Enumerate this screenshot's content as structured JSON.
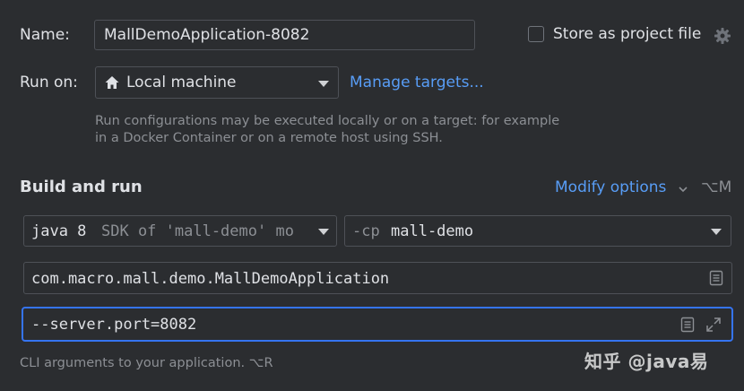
{
  "name": {
    "label": "Name:",
    "value": "MallDemoApplication-8082"
  },
  "store": {
    "label": "Store as project file",
    "checked": false,
    "icon": "gear-icon"
  },
  "run_on": {
    "label": "Run on:",
    "value": "Local machine",
    "icon": "home-icon",
    "manage_link": "Manage targets...",
    "help_line1": "Run configurations may be executed locally or on a target: for example",
    "help_line2": "in a Docker Container or on a remote host using SSH."
  },
  "build": {
    "title": "Build and run",
    "modify_label": "Modify options",
    "modify_shortcut": "⌥M",
    "sdk_main": "java 8",
    "sdk_detail": "SDK of 'mall-demo' mo",
    "cp_prefix": "-cp",
    "cp_value": "mall-demo",
    "main_class": "com.macro.mall.demo.MallDemoApplication",
    "program_args": "--server.port=8082",
    "args_hint": "CLI arguments to your application. ⌥R"
  },
  "watermark": "知乎 @java易",
  "colors": {
    "accent": "#589df6",
    "focus_border": "#3574f0",
    "background": "#2b2d30"
  }
}
